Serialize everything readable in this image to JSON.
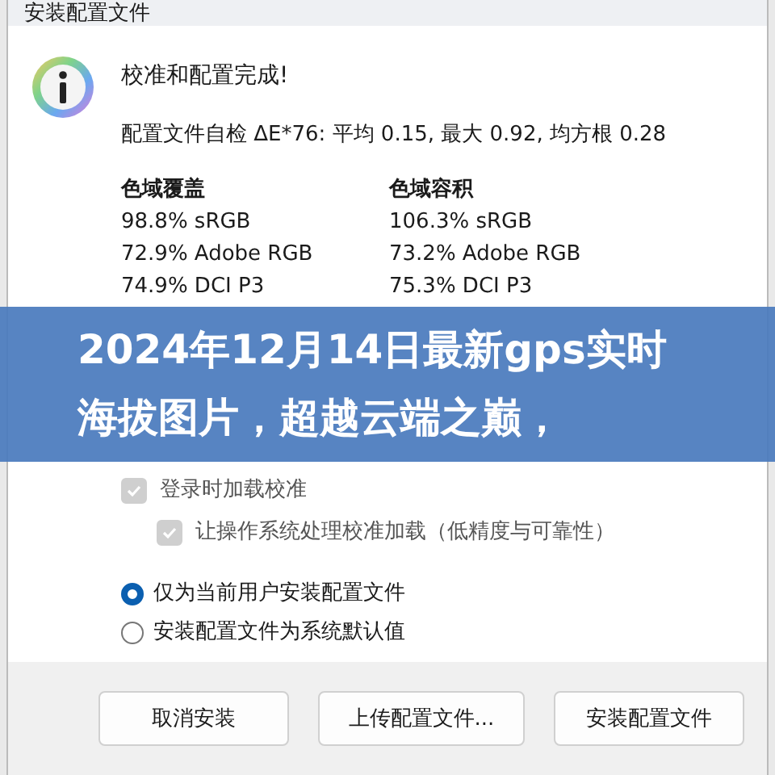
{
  "window": {
    "title": "安装配置文件"
  },
  "heading": "校准和配置完成!",
  "self_check": "配置文件自检 ΔE*76: 平均 0.15, 最大 0.92, 均方根 0.28",
  "gamut": [
    {
      "title": "色域覆盖",
      "values": [
        "98.8% sRGB",
        "72.9% Adobe RGB",
        "74.9% DCI P3"
      ]
    },
    {
      "title": "色域容积",
      "values": [
        "106.3% sRGB",
        "73.2% Adobe RGB",
        "75.3% DCI P3"
      ]
    }
  ],
  "banner": {
    "text": "2024年12月14日最新gps实时海拔图片，超越云端之巅，"
  },
  "checkboxes": [
    {
      "label": "登录时加载校准",
      "checked": true,
      "disabled": true,
      "children": [
        {
          "label": "让操作系统处理校准加载（低精度与可靠性）",
          "checked": true,
          "disabled": true
        }
      ]
    }
  ],
  "radios": [
    {
      "label": "仅为当前用户安装配置文件",
      "selected": true
    },
    {
      "label": "安装配置文件为系统默认值",
      "selected": false
    }
  ],
  "buttons": [
    "取消安装",
    "上传配置文件...",
    "安装配置文件"
  ]
}
